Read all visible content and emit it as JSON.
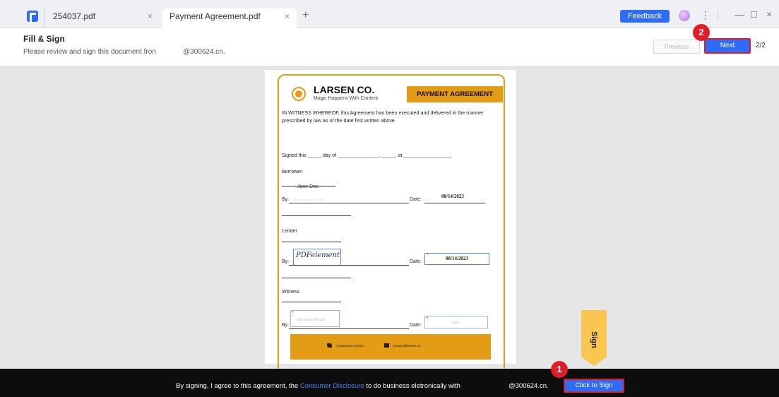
{
  "tabs": [
    {
      "label": "254037.pdf",
      "close": "×"
    },
    {
      "label": "Payment Agreement.pdf",
      "close": "×"
    }
  ],
  "new_tab": "+",
  "toolbar": {
    "feedback_label": "Feedback",
    "more": "⋮",
    "minimize": "—",
    "maximize": "☐",
    "close": "×"
  },
  "header": {
    "title": "Fill & Sign",
    "subtitle": "Please review and sign this document fron",
    "email": "@300624.cn.",
    "previous_label": "Previous",
    "next_label": "Next",
    "page_indicator": "2/2"
  },
  "steps": {
    "next_step": "2",
    "sign_step": "1"
  },
  "document": {
    "company": "LARSEN CO.",
    "tagline": "Magic Happens With Content",
    "title": "PAYMENT AGREEMENT",
    "witness_clause": "IN WITNESS WHEREOF, this Agreement has been executed and delivered in the manner prescribed by law as of the date first written above.",
    "signed_this": "Signed this _____ day of _______________, _____, at _________________.",
    "borrower_label": "Borrower:",
    "borrower_name": "Jane Doe",
    "by_label": "By:",
    "date_label": "Date:",
    "borrower_date": "08/14/2023",
    "lender_label": "Lender",
    "lender_signature": "PDFelement",
    "lender_date": "08/14/2023",
    "witness_label": "Witness",
    "required_mark": "*",
    "signature_placeholder": "Signature Default",
    "date_placeholder": "Date",
    "phone": "+1(555)244-34322",
    "email": "contact@larsen.co"
  },
  "sign_tab_label": "Sign",
  "bottom_bar": {
    "prefix": "By signing, I agree to this agreement, the",
    "link": "Consumer Disclosure",
    "suffix": "to do business eletronically with",
    "email": "@300624.cn.",
    "click_to_sign": "Click to Sign"
  }
}
